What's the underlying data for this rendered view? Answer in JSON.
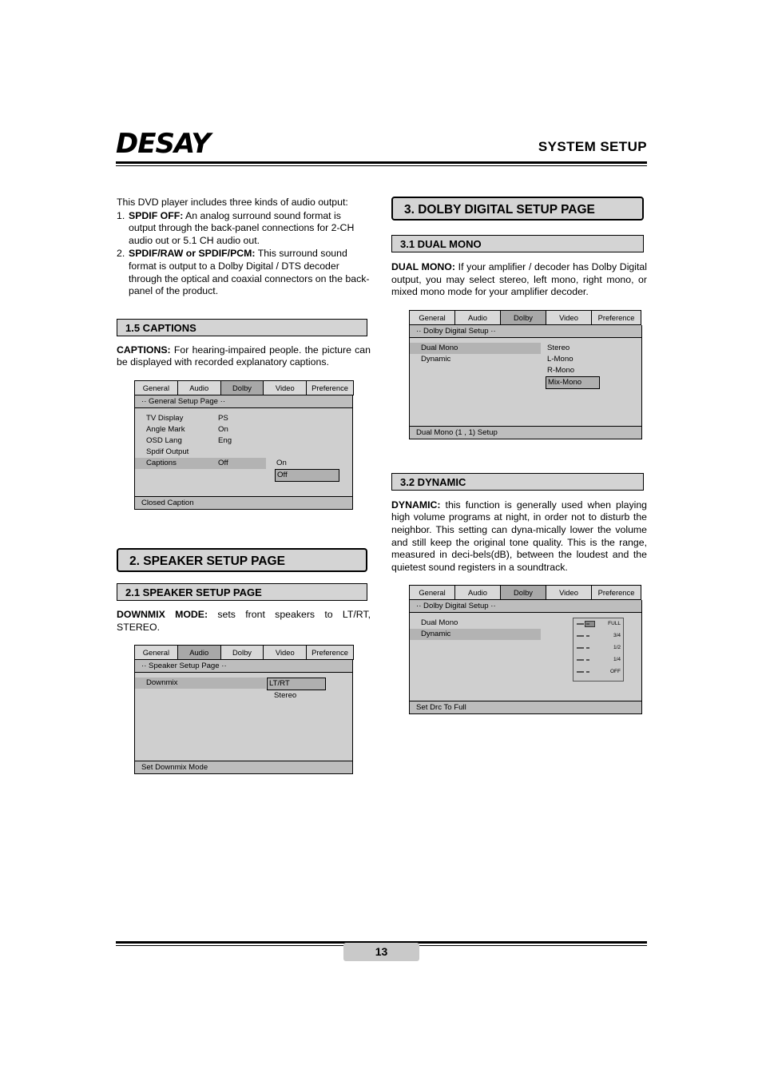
{
  "header": {
    "logo": "DESAY",
    "title": "SYSTEM SETUP"
  },
  "left": {
    "intro": "This DVD player includes three kinds of audio output:",
    "items": [
      {
        "num": "1.",
        "bold": "SPDIF OFF:",
        "text": " An analog surround sound format is output through the back-panel connections for 2-CH audio out or 5.1 CH audio out."
      },
      {
        "num": "2.",
        "bold": "SPDIF/RAW or SPDIF/PCM:",
        "text": " This surround sound format  is  output to a Dolby Digital / DTS decoder through the optical and  coaxial connectors on the back-panel of  the product."
      }
    ],
    "captions_bar": "1.5 CAPTIONS",
    "captions_bold": "CAPTIONS:",
    "captions_text": " For hearing-impaired people. the picture can be displayed with recorded explanatory captions.",
    "osd_general": {
      "tabs": [
        "General",
        "Audio",
        "Dolby",
        "Video",
        "Preference"
      ],
      "selected_tab": "General",
      "title": "·· General Setup Page ··",
      "rows": [
        {
          "label": "TV Display",
          "value": "PS",
          "highlight": false
        },
        {
          "label": "Angle Mark",
          "value": "On",
          "highlight": false
        },
        {
          "label": "OSD Lang",
          "value": "Eng",
          "highlight": false
        },
        {
          "label": "Spdif Output",
          "value": "",
          "highlight": false
        },
        {
          "label": "Captions",
          "value": "Off",
          "highlight": true
        }
      ],
      "menu": [
        "On",
        "Off"
      ],
      "menu_selected": "Off",
      "footer": "Closed Caption"
    },
    "speaker_bar": "2. SPEAKER SETUP PAGE",
    "speaker_sub_bar": "2.1 SPEAKER SETUP PAGE",
    "downmix_bold": "DOWNMIX MODE:",
    "downmix_text": "  sets front speakers  to  LT/RT, STEREO.",
    "osd_speaker": {
      "tabs": [
        "General",
        "Audio",
        "Dolby",
        "Video",
        "Preference"
      ],
      "selected_tab": "Audio",
      "title": "·· Speaker Setup Page ··",
      "rows": [
        {
          "label": "Downmix",
          "value": "",
          "highlight": true
        }
      ],
      "menu": [
        "LT/RT",
        "Stereo"
      ],
      "menu_selected": "LT/RT",
      "footer": "Set Downmix Mode"
    }
  },
  "right": {
    "dolby_bar": "3. DOLBY DIGITAL SETUP PAGE",
    "dualmono_bar": "3.1 DUAL MONO",
    "dualmono_bold": "DUAL  MONO:",
    "dualmono_text": "   If  your  amplifier / decoder  has Dolby  Digital output,  you may select  stereo,  left mono, right mono,  or  mixed mono mode for your amplifier decoder.",
    "osd_dualmono": {
      "tabs": [
        "General",
        "Audio",
        "Dolby",
        "Video",
        "Preference"
      ],
      "selected_tab": "Dolby",
      "title": "·· Dolby Digital Setup ··",
      "rows": [
        {
          "label": "Dual Mono",
          "value": "",
          "highlight": true
        },
        {
          "label": "Dynamic",
          "value": "",
          "highlight": false
        }
      ],
      "menu": [
        "Stereo",
        "L-Mono",
        "R-Mono",
        "Mix-Mono"
      ],
      "menu_selected": "Mix-Mono",
      "footer": "Dual Mono (1 , 1) Setup"
    },
    "dynamic_bar": "3.2  DYNAMIC",
    "dynamic_bold": "DYNAMIC:",
    "dynamic_text": "  this  function is generally used  when playing  high  volume  programs at night,  in order not to disturb the neighbor. This setting can dyna-mically lower the volume and still keep the original tone  quality.  This is the range, measured in deci-bels(dB),  between  the  loudest  and  the quietest sound registers in a soundtrack.",
    "osd_dynamic": {
      "tabs": [
        "General",
        "Audio",
        "Dolby",
        "Video",
        "Preference"
      ],
      "selected_tab": "Dolby",
      "title": "·· Dolby Digital Setup ··",
      "rows": [
        {
          "label": "Dual Mono",
          "value": "",
          "highlight": false
        },
        {
          "label": "Dynamic",
          "value": "",
          "highlight": true
        }
      ],
      "drc_labels": [
        "FULL",
        "3/4",
        "1/2",
        "1/4",
        "OFF"
      ],
      "footer": "Set Drc To Full"
    }
  },
  "footer": {
    "page_number": "13"
  }
}
